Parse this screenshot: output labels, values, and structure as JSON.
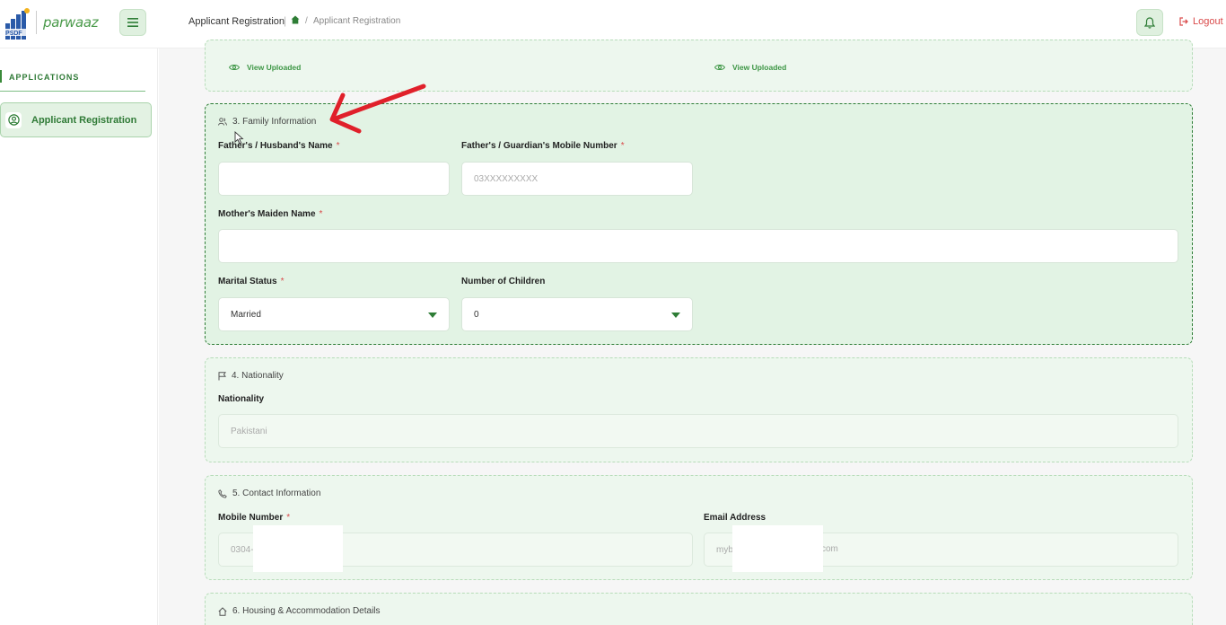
{
  "header": {
    "logo_text": "PSDF",
    "brand": "parwaaz",
    "breadcrumb_title": "Applicant Registration",
    "breadcrumb_current": "Applicant Registration",
    "logout": "Logout"
  },
  "sidebar": {
    "heading": "APPLICATIONS",
    "items": [
      {
        "label": "Applicant Registration",
        "icon": "user-circle-icon"
      }
    ]
  },
  "uploads": {
    "view_uploaded_1": "View Uploaded",
    "view_uploaded_2": "View Uploaded"
  },
  "family": {
    "title": "3. Family Information",
    "father_label": "Father's / Husband's Name",
    "father_value": "",
    "guardian_mobile_label": "Father's / Guardian's Mobile Number",
    "guardian_mobile_placeholder": "03XXXXXXXXX",
    "mother_label": "Mother's Maiden Name",
    "mother_value": "",
    "marital_label": "Marital Status",
    "marital_value": "Married",
    "children_label": "Number of Children",
    "children_value": "0",
    "required_mark": "*"
  },
  "nationality": {
    "title": "4. Nationality",
    "label": "Nationality",
    "value": "Pakistani"
  },
  "contact": {
    "title": "5. Contact Information",
    "mobile_label": "Mobile Number",
    "mobile_value": "0304-",
    "email_label": "Email Address",
    "email_value": "myb",
    "email_suffix": "l.com"
  },
  "housing": {
    "title": "6. Housing & Accommodation Details"
  },
  "colors": {
    "accent": "#2e7d36",
    "required": "#d94a4a",
    "card_bg": "#edf7ee",
    "annotation_arrow": "#e0202a"
  }
}
